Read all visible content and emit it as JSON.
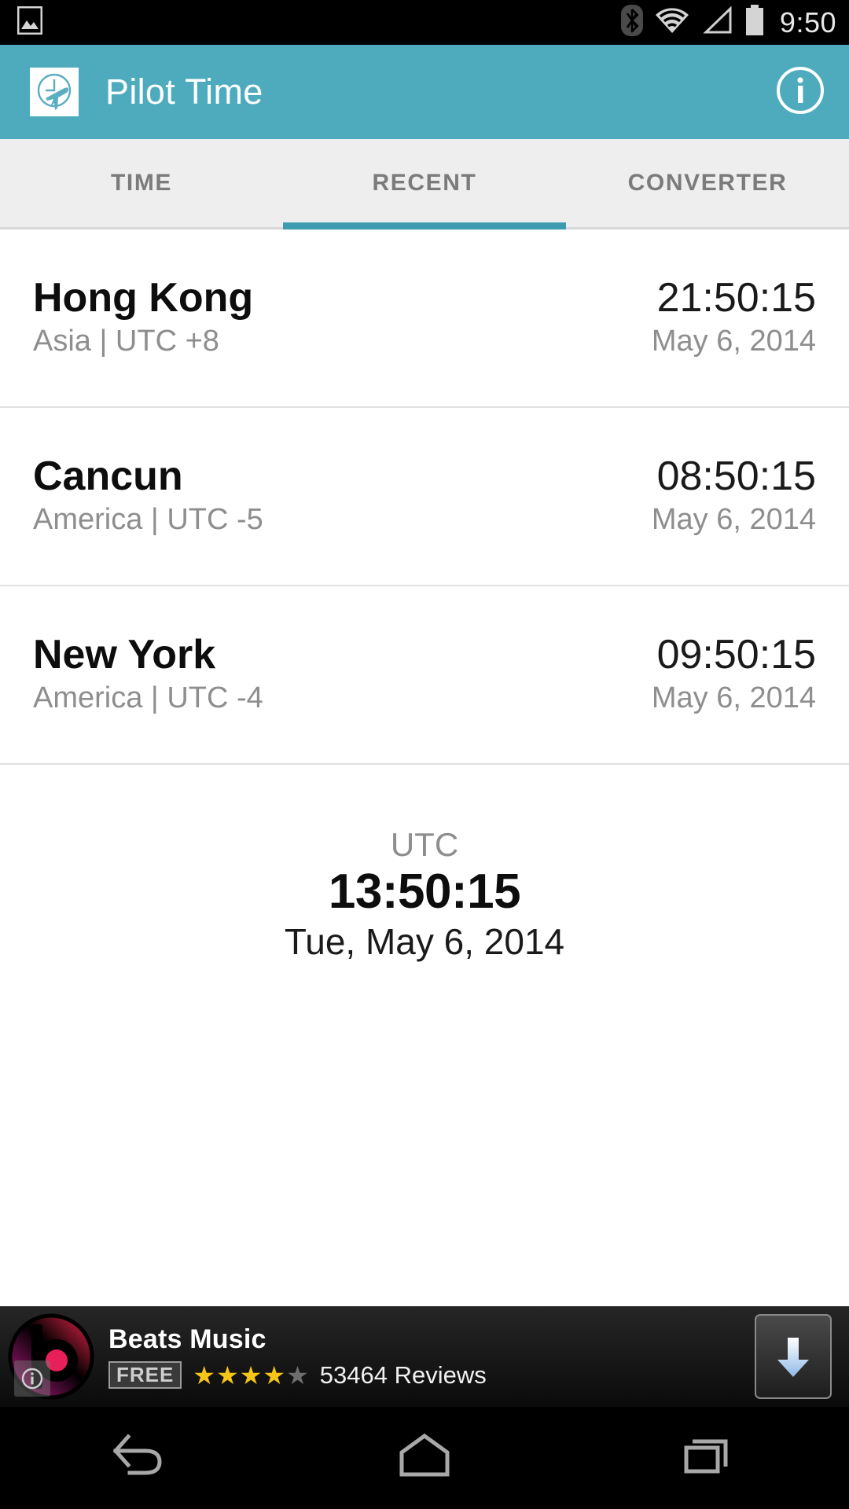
{
  "status_bar": {
    "clock": "9:50",
    "icons": [
      "image-icon",
      "bluetooth-icon",
      "wifi-icon",
      "signal-icon",
      "battery-icon"
    ]
  },
  "action_bar": {
    "title": "Pilot Time",
    "app_icon": "clock-airplane-icon",
    "info_icon": "info-icon",
    "color": "#4dabbd"
  },
  "tabs": {
    "items": [
      {
        "label": "TIME",
        "active": false
      },
      {
        "label": "RECENT",
        "active": true
      },
      {
        "label": "CONVERTER",
        "active": false
      }
    ],
    "indicator_color": "#3f9cb0"
  },
  "list": {
    "rows": [
      {
        "city": "Hong Kong",
        "zone": "Asia | UTC +8",
        "time": "21:50:15",
        "date": "May 6, 2014"
      },
      {
        "city": "Cancun",
        "zone": "America | UTC -5",
        "time": "08:50:15",
        "date": "May 6, 2014"
      },
      {
        "city": "New York",
        "zone": "America | UTC -4",
        "time": "09:50:15",
        "date": "May 6, 2014"
      }
    ]
  },
  "utc": {
    "label": "UTC",
    "time": "13:50:15",
    "date": "Tue, May 6, 2014"
  },
  "ad": {
    "title": "Beats Music",
    "price_badge": "FREE",
    "rating_filled": 4,
    "rating_total": 5,
    "reviews": "53464 Reviews",
    "download_icon": "download-arrow-icon",
    "info_icon": "ad-info-icon",
    "logo": "beats-logo-icon"
  },
  "nav_bar": {
    "buttons": [
      {
        "name": "back-button",
        "icon": "back-arrow-icon"
      },
      {
        "name": "home-button",
        "icon": "home-icon"
      },
      {
        "name": "recents-button",
        "icon": "recents-icon"
      }
    ]
  }
}
